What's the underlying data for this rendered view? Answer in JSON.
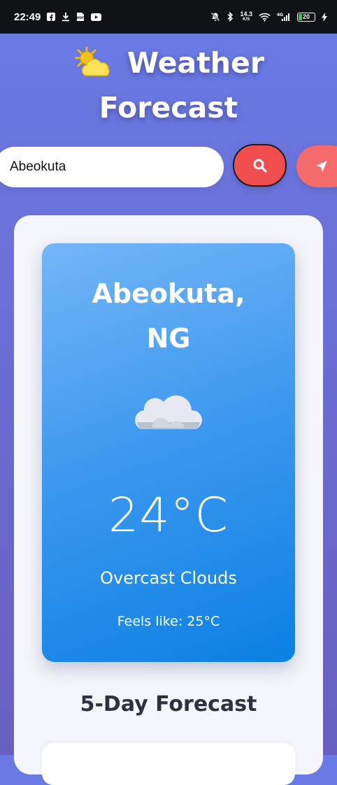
{
  "status_bar": {
    "time": "22:49",
    "network_speed": "14.3",
    "network_speed_unit": "K/S",
    "network_type": "4G",
    "battery_level": "20",
    "left_icons": [
      "facebook-icon",
      "download-icon",
      "pdf-file-icon",
      "youtube-icon"
    ],
    "right_icons": [
      "mute-icon",
      "bluetooth-icon",
      "wifi-icon",
      "signal-icon",
      "battery-icon",
      "charging-icon"
    ]
  },
  "header": {
    "emoji": "sun-behind-cloud",
    "title_line1": "Weather",
    "title_line2": "Forecast"
  },
  "search": {
    "value": "Abeokuta",
    "search_icon": "search-icon",
    "locate_icon": "location-arrow-icon"
  },
  "current": {
    "city": "Abeokuta, NG",
    "icon": "cloud-icon",
    "temperature": "24°C",
    "condition": "Overcast Clouds",
    "feels_like": "Feels like: 25°C"
  },
  "forecast": {
    "heading": "5-Day Forecast"
  },
  "colors": {
    "background_top": "#6a7be6",
    "background_bottom": "#6a5fbf",
    "search_button": "#f04e4e",
    "locate_button": "#f56a6a",
    "weather_card_start": "#74b6f8",
    "weather_card_end": "#0b80e4",
    "heading_text": "#2d3142"
  }
}
